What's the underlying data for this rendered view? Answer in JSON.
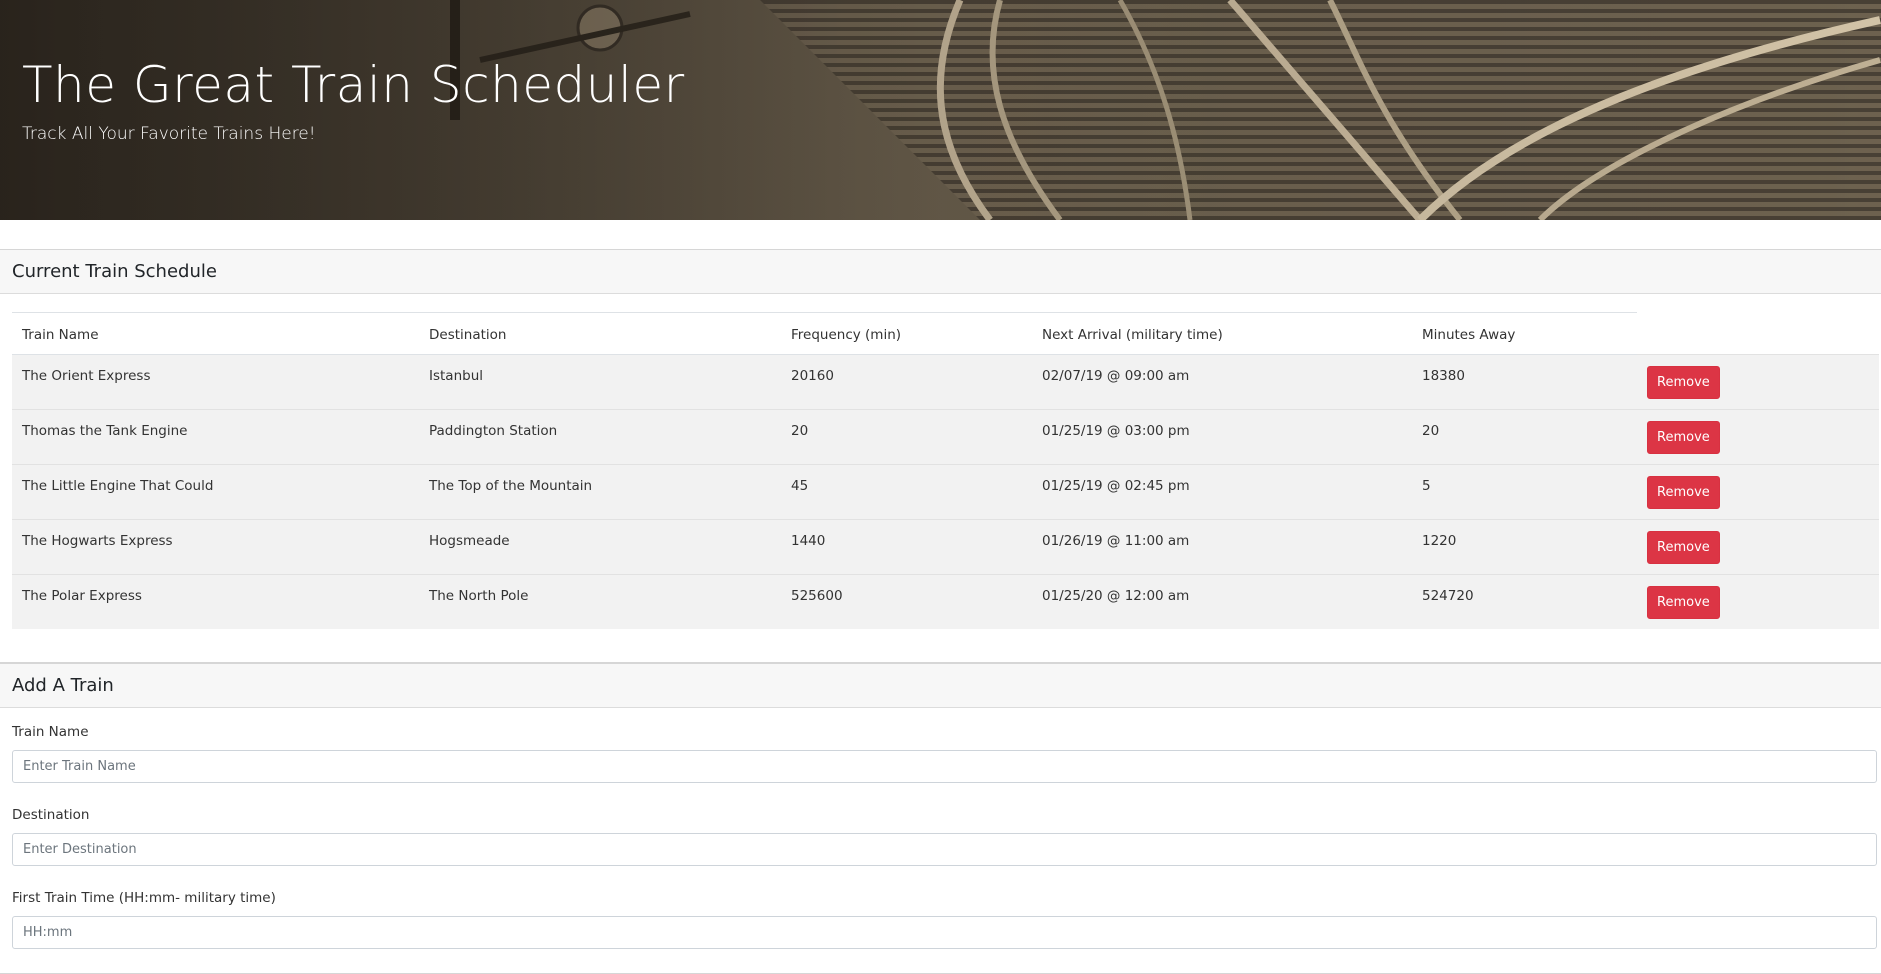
{
  "header": {
    "title": "The Great Train Scheduler",
    "subtitle": "Track All Your Favorite Trains Here!"
  },
  "schedule": {
    "heading": "Current Train Schedule",
    "columns": [
      "Train Name",
      "Destination",
      "Frequency (min)",
      "Next Arrival (military time)",
      "Minutes Away"
    ],
    "remove_label": "Remove",
    "rows": [
      {
        "name": "The Orient Express",
        "destination": "Istanbul",
        "frequency": "20160",
        "next_arrival": "02/07/19 @ 09:00 am",
        "minutes_away": "18380"
      },
      {
        "name": "Thomas the Tank Engine",
        "destination": "Paddington Station",
        "frequency": "20",
        "next_arrival": "01/25/19 @ 03:00 pm",
        "minutes_away": "20"
      },
      {
        "name": "The Little Engine That Could",
        "destination": "The Top of the Mountain",
        "frequency": "45",
        "next_arrival": "01/25/19 @ 02:45 pm",
        "minutes_away": "5"
      },
      {
        "name": "The Hogwarts Express",
        "destination": "Hogsmeade",
        "frequency": "1440",
        "next_arrival": "01/26/19 @ 11:00 am",
        "minutes_away": "1220"
      },
      {
        "name": "The Polar Express",
        "destination": "The North Pole",
        "frequency": "525600",
        "next_arrival": "01/25/20 @ 12:00 am",
        "minutes_away": "524720"
      }
    ]
  },
  "add_train": {
    "heading": "Add A Train",
    "fields": [
      {
        "label": "Train Name",
        "placeholder": "Enter Train Name",
        "value": ""
      },
      {
        "label": "Destination",
        "placeholder": "Enter Destination",
        "value": ""
      },
      {
        "label": "First Train Time (HH:mm- military time)",
        "placeholder": "HH:mm",
        "value": ""
      }
    ]
  },
  "colors": {
    "remove_button": "#dc3545",
    "card_header_bg": "#f7f7f7",
    "row_bg": "#f2f2f2"
  }
}
